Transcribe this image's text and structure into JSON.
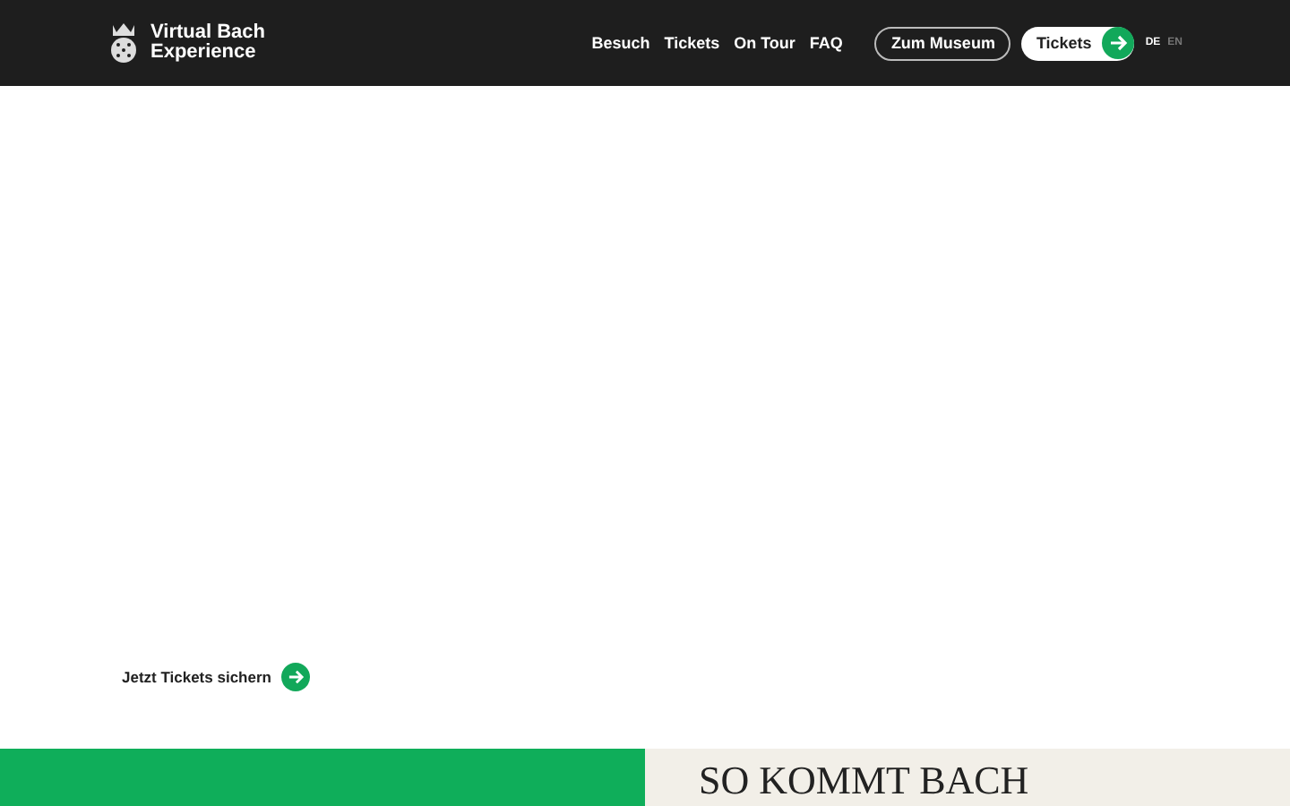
{
  "header": {
    "logo_text": [
      "Virtual Bach",
      "Experience"
    ],
    "nav": [
      "Besuch",
      "Tickets",
      "On Tour",
      "FAQ"
    ],
    "museum_button": "Zum Museum",
    "tickets_button": "Tickets",
    "languages": [
      {
        "label": "DE",
        "selected": true
      },
      {
        "label": "EN",
        "selected": false
      }
    ]
  },
  "hero": {
    "cta": "Jetzt Tickets sichern"
  },
  "section": {
    "heading": "SO KOMMT BACH"
  }
}
